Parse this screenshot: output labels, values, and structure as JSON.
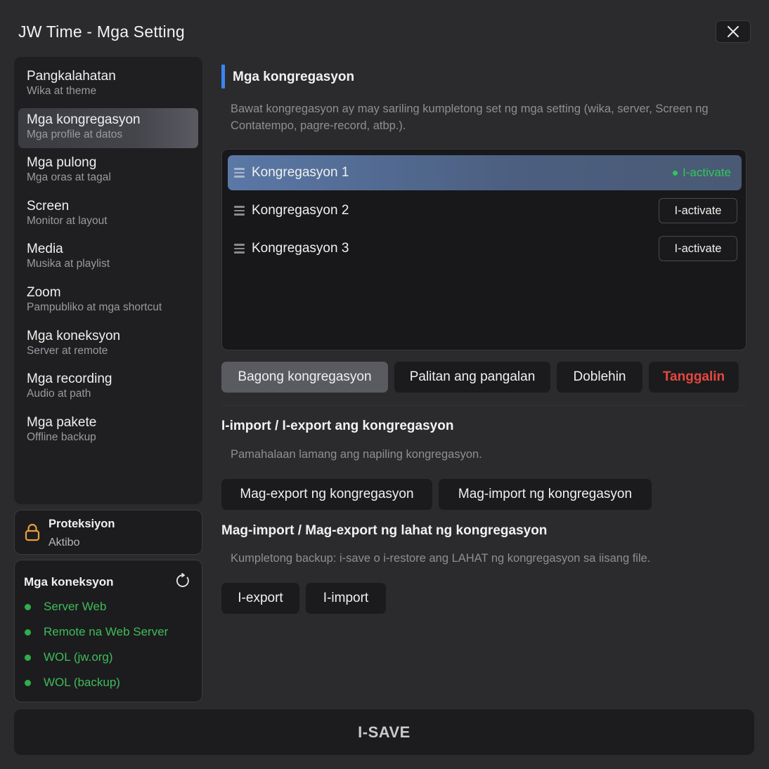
{
  "window": {
    "title": "JW Time - Mga Setting"
  },
  "nav": [
    {
      "label": "Pangkalahatan",
      "sub": "Wika at theme"
    },
    {
      "label": "Mga kongregasyon",
      "sub": "Mga profile at datos"
    },
    {
      "label": "Mga pulong",
      "sub": "Mga oras at tagal"
    },
    {
      "label": "Screen",
      "sub": "Monitor at layout"
    },
    {
      "label": "Media",
      "sub": "Musika at playlist"
    },
    {
      "label": "Zoom",
      "sub": "Pampubliko at mga shortcut"
    },
    {
      "label": "Mga koneksyon",
      "sub": "Server at remote"
    },
    {
      "label": "Mga recording",
      "sub": "Audio at path"
    },
    {
      "label": "Mga pakete",
      "sub": "Offline backup"
    }
  ],
  "protection": {
    "title": "Proteksiyon",
    "status": "Aktibo",
    "icon": "lock-icon",
    "icon_color": "#e8a13a"
  },
  "connections": {
    "title": "Mga koneksyon",
    "status_color": "#3dbb5a",
    "items": [
      "Server Web",
      "Remote na Web Server",
      "WOL (jw.org)",
      "WOL (backup)"
    ]
  },
  "main": {
    "section_title": "Mga kongregasyon",
    "description": "Bawat kongregasyon ay may sariling kumpletong set ng mga setting (wika, server, Screen ng Contatempo, pagre-record, atbp.).",
    "congregations": [
      {
        "name": "Kongregasyon 1",
        "action": "I-activate",
        "active": true
      },
      {
        "name": "Kongregasyon 2",
        "action": "I-activate",
        "active": false
      },
      {
        "name": "Kongregasyon 3",
        "action": "I-activate",
        "active": false
      }
    ],
    "buttons": {
      "new": "Bagong kongregasyon",
      "rename": "Palitan ang pangalan",
      "duplicate": "Doblehin",
      "delete": "Tanggalin"
    },
    "import_export": {
      "title": "I-import / I-export ang kongregasyon",
      "desc": "Pamahalaan lamang ang napiling kongregasyon.",
      "export_label": "Mag-export ng kongregasyon",
      "import_label": "Mag-import ng kongregasyon"
    },
    "all": {
      "title": "Mag-import / Mag-export ng lahat ng kongregasyon",
      "desc": "Kumpletong backup: i-save o i-restore ang LAHAT ng kongregasyon sa iisang file.",
      "export_label": "I-export",
      "import_label": "I-import"
    }
  },
  "save": {
    "label": "I-SAVE"
  },
  "colors": {
    "accent": "#3b86f0",
    "danger": "#e5483f",
    "active_green": "#2fc85a"
  }
}
